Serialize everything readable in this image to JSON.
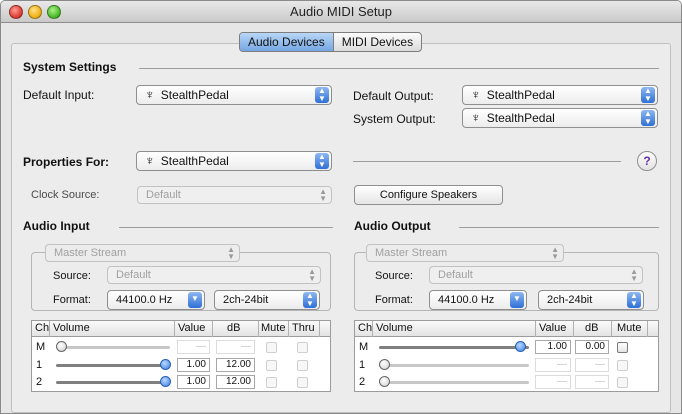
{
  "window": {
    "title": "Audio MIDI Setup"
  },
  "tabs": [
    {
      "label": "Audio Devices",
      "selected": true
    },
    {
      "label": "MIDI Devices",
      "selected": false
    }
  ],
  "system_settings": {
    "heading": "System Settings",
    "default_input_label": "Default Input:",
    "default_input_value": "StealthPedal",
    "default_output_label": "Default Output:",
    "default_output_value": "StealthPedal",
    "system_output_label": "System Output:",
    "system_output_value": "StealthPedal"
  },
  "properties": {
    "label": "Properties For:",
    "device": "StealthPedal",
    "help": "?",
    "clock_source_label": "Clock Source:",
    "clock_source_value": "Default",
    "configure_speakers": "Configure Speakers"
  },
  "audio_input": {
    "heading": "Audio Input",
    "stream": "Master Stream",
    "source_label": "Source:",
    "source_value": "Default",
    "format_label": "Format:",
    "format_rate": "44100.0 Hz",
    "format_bits": "2ch-24bit",
    "columns": [
      "Ch",
      "Volume",
      "Value",
      "dB",
      "Mute",
      "Thru"
    ],
    "rows": [
      {
        "ch": "M",
        "value": "—",
        "db": "—",
        "level": 0
      },
      {
        "ch": "1",
        "value": "1.00",
        "db": "12.00",
        "level": 1
      },
      {
        "ch": "2",
        "value": "1.00",
        "db": "12.00",
        "level": 1
      }
    ]
  },
  "audio_output": {
    "heading": "Audio Output",
    "stream": "Master Stream",
    "source_label": "Source:",
    "source_value": "Default",
    "format_label": "Format:",
    "format_rate": "44100.0 Hz",
    "format_bits": "2ch-24bit",
    "columns": [
      "Ch",
      "Volume",
      "Value",
      "dB",
      "Mute"
    ],
    "rows": [
      {
        "ch": "M",
        "value": "1.00",
        "db": "0.00",
        "level": 1
      },
      {
        "ch": "1",
        "value": "—",
        "db": "—",
        "level": 0
      },
      {
        "ch": "2",
        "value": "—",
        "db": "—",
        "level": 0
      }
    ]
  },
  "icons": {
    "usb": "usb-icon",
    "popup_arrow": "updown-arrows-icon"
  }
}
